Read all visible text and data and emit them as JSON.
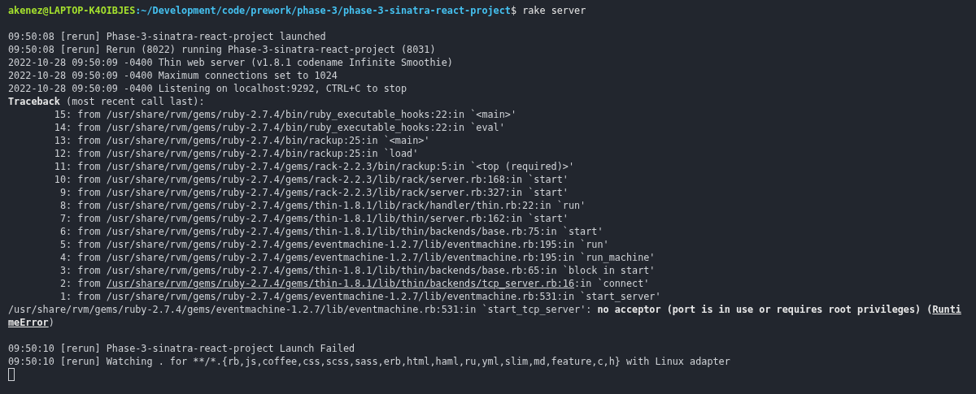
{
  "terminal": {
    "lines": [
      {
        "kind": "prompt",
        "user": "akenez@LAPTOP-K4OIBJES",
        "path": ":~/Development/code/prework/phase-3/phase-3-sinatra-react-project",
        "command": "$ rake server"
      },
      {
        "kind": "blank"
      },
      {
        "kind": "text",
        "text": "09:50:08 [rerun] Phase-3-sinatra-react-project launched"
      },
      {
        "kind": "text",
        "text": "09:50:08 [rerun] Rerun (8022) running Phase-3-sinatra-react-project (8031)"
      },
      {
        "kind": "text",
        "text": "2022-10-28 09:50:09 -0400 Thin web server (v1.8.1 codename Infinite Smoothie)"
      },
      {
        "kind": "text",
        "text": "2022-10-28 09:50:09 -0400 Maximum connections set to 1024"
      },
      {
        "kind": "text",
        "text": "2022-10-28 09:50:09 -0400 Listening on localhost:9292, CTRL+C to stop"
      },
      {
        "kind": "traceback-header",
        "text": "**Traceback** (most recent call last):"
      },
      {
        "kind": "frame",
        "text": "15: from /usr/share/rvm/gems/ruby-2.7.4/bin/ruby_executable_hooks:22:in `<main>'"
      },
      {
        "kind": "frame",
        "text": "14: from /usr/share/rvm/gems/ruby-2.7.4/bin/ruby_executable_hooks:22:in `eval'"
      },
      {
        "kind": "frame",
        "text": "13: from /usr/share/rvm/gems/ruby-2.7.4/bin/rackup:25:in `<main>'"
      },
      {
        "kind": "frame",
        "text": "12: from /usr/share/rvm/gems/ruby-2.7.4/bin/rackup:25:in `load'"
      },
      {
        "kind": "frame",
        "text": "11: from /usr/share/rvm/gems/ruby-2.7.4/gems/rack-2.2.3/bin/rackup:5:in `<top (required)>'"
      },
      {
        "kind": "frame",
        "text": "10: from /usr/share/rvm/gems/ruby-2.7.4/gems/rack-2.2.3/lib/rack/server.rb:168:in `start'"
      },
      {
        "kind": "frame",
        "text": " 9: from /usr/share/rvm/gems/ruby-2.7.4/gems/rack-2.2.3/lib/rack/server.rb:327:in `start'"
      },
      {
        "kind": "frame",
        "text": " 8: from /usr/share/rvm/gems/ruby-2.7.4/gems/thin-1.8.1/lib/rack/handler/thin.rb:22:in `run'"
      },
      {
        "kind": "frame",
        "text": " 7: from /usr/share/rvm/gems/ruby-2.7.4/gems/thin-1.8.1/lib/thin/server.rb:162:in `start'"
      },
      {
        "kind": "frame",
        "text": " 6: from /usr/share/rvm/gems/ruby-2.7.4/gems/thin-1.8.1/lib/thin/backends/base.rb:75:in `start'"
      },
      {
        "kind": "frame",
        "text": " 5: from /usr/share/rvm/gems/ruby-2.7.4/gems/eventmachine-1.2.7/lib/eventmachine.rb:195:in `run'"
      },
      {
        "kind": "frame",
        "text": " 4: from /usr/share/rvm/gems/ruby-2.7.4/gems/eventmachine-1.2.7/lib/eventmachine.rb:195:in `run_machine'"
      },
      {
        "kind": "frame",
        "text": " 3: from /usr/share/rvm/gems/ruby-2.7.4/gems/thin-1.8.1/lib/thin/backends/base.rb:65:in `block in start'"
      },
      {
        "kind": "link-frame",
        "before": " 2: from ",
        "link": "/usr/share/rvm/gems/ruby-2.7.4/gems/thin-1.8.1/lib/thin/backends/tcp_server.rb:16",
        "after": ":in `connect'"
      },
      {
        "kind": "frame",
        "text": " 1: from /usr/share/rvm/gems/ruby-2.7.4/gems/eventmachine-1.2.7/lib/eventmachine.rb:531:in `start_server'"
      },
      {
        "kind": "error",
        "text": "/usr/share/rvm/gems/ruby-2.7.4/gems/eventmachine-1.2.7/lib/eventmachine.rb:531:in `start_tcp_server': **no acceptor (port is in use or requires root privileges) (**",
        "error_class": "Runti"
      },
      {
        "kind": "error-tail",
        "error_class": "meError",
        "text": ")"
      },
      {
        "kind": "blank"
      },
      {
        "kind": "text",
        "text": "09:50:10 [rerun] Phase-3-sinatra-react-project Launch Failed"
      },
      {
        "kind": "text",
        "text": "09:50:10 [rerun] Watching . for **/*.{rb,js,coffee,css,scss,sass,erb,html,haml,ru,yml,slim,md,feature,c,h} with Linux adapter"
      },
      {
        "kind": "cursor"
      }
    ]
  }
}
